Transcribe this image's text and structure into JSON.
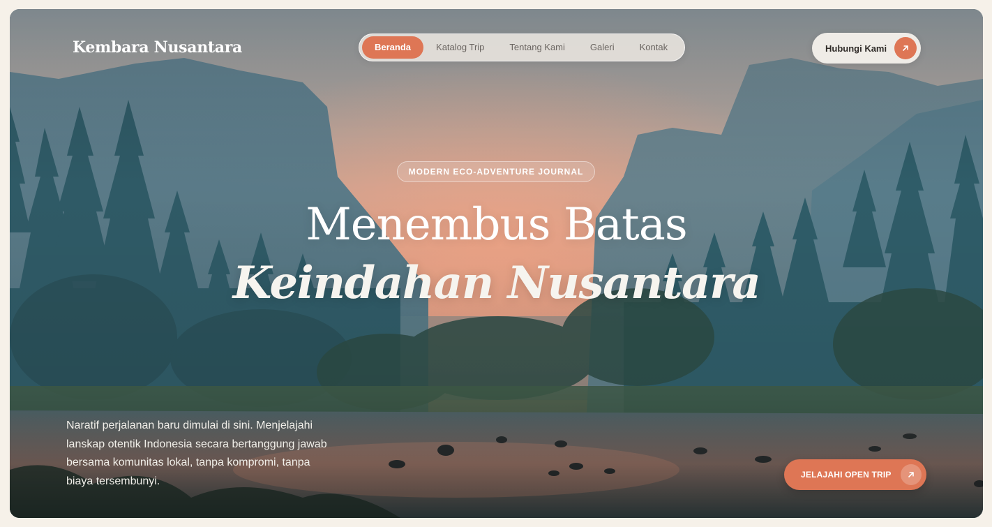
{
  "brand": {
    "name": "Kembara Nusantara"
  },
  "nav": {
    "items": [
      {
        "label": "Beranda",
        "active": true
      },
      {
        "label": "Katalog Trip",
        "active": false
      },
      {
        "label": "Tentang Kami",
        "active": false
      },
      {
        "label": "Galeri",
        "active": false
      },
      {
        "label": "Kontak",
        "active": false
      }
    ]
  },
  "header": {
    "contact_label": "Hubungi Kami",
    "contact_icon": "arrow-up-right-icon"
  },
  "hero": {
    "badge": "MODERN ECO-ADVENTURE JOURNAL",
    "title_line1": "Menembus Batas",
    "title_line2": "Keindahan Nusantara",
    "intro": "Naratif perjalanan baru dimulai di sini. Menjelajahi lanskap otentik Indonesia secara bertanggung jawab bersama komunitas lokal, tanpa kompromi, tanpa biaya tersembunyi.",
    "cta_label": "JELAJAHI OPEN TRIP",
    "cta_icon": "arrow-up-right-icon"
  },
  "colors": {
    "accent": "#de7655",
    "page_background": "#f6f1e9",
    "text_light": "#ffffff"
  }
}
